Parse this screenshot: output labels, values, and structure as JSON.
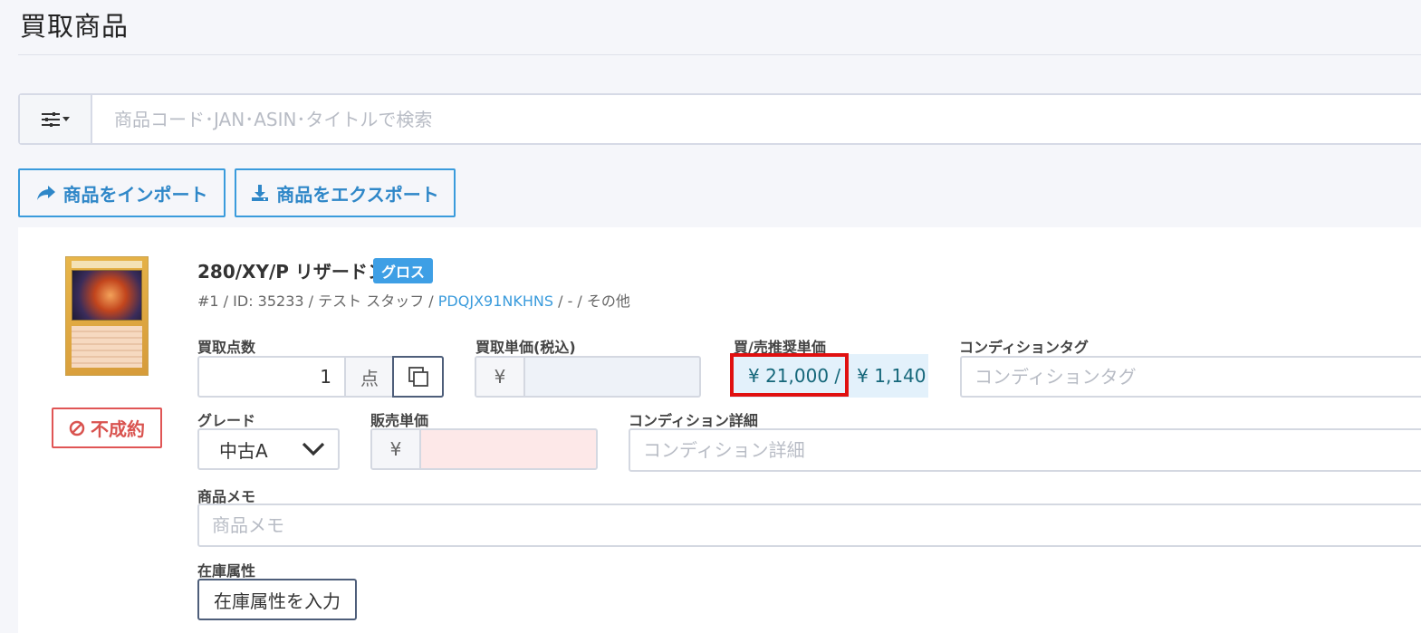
{
  "page": {
    "title": "買取商品"
  },
  "search": {
    "placeholder": "商品コード･JAN･ASIN･タイトルで検索",
    "value": ""
  },
  "toolbar": {
    "import_label": "商品をインポート",
    "export_label": "商品をエクスポート"
  },
  "product": {
    "title": "280/XY/P リザードン",
    "badge": "グロス",
    "meta": {
      "prefix": "#1 / ID: 35233 / テスト スタッフ / ",
      "code_link": "PDQJX91NKHNS",
      "suffix": " / - / その他"
    },
    "status_label": "不成約",
    "fields": {
      "quantity": {
        "label": "買取点数",
        "value": "1",
        "unit": "点"
      },
      "buy_price": {
        "label": "買取単価(税込)",
        "currency": "¥",
        "value": ""
      },
      "recommended": {
        "label": "買/売推奨単価",
        "buy": "¥ 21,000 /",
        "sell": "¥ 1,140"
      },
      "condition_tag": {
        "label": "コンディションタグ",
        "placeholder": "コンディションタグ"
      },
      "grade": {
        "label": "グレード",
        "value": "中古A"
      },
      "sale_price": {
        "label": "販売単価",
        "currency": "¥",
        "value": ""
      },
      "condition_detail": {
        "label": "コンディション詳細",
        "placeholder": "コンディション詳細"
      },
      "memo": {
        "label": "商品メモ",
        "placeholder": "商品メモ"
      },
      "stock_attr": {
        "label": "在庫属性",
        "button_label": "在庫属性を入力"
      }
    }
  },
  "colors": {
    "accent": "#3a9bdc",
    "danger": "#d9534f",
    "highlight": "#e01010",
    "reco_bg": "#e3f1fb",
    "sale_bg": "#fde8e8"
  }
}
